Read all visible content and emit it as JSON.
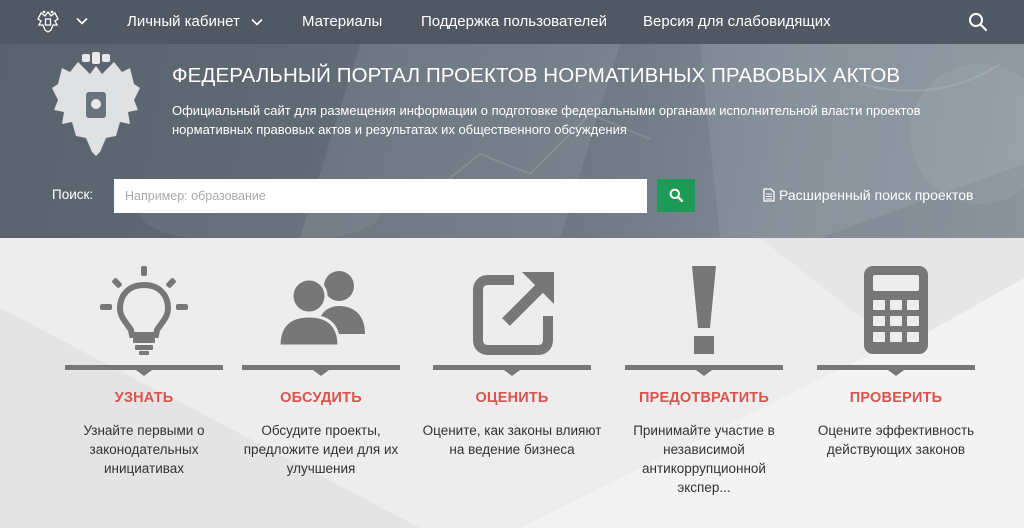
{
  "nav": {
    "items": [
      {
        "label": "Личный кабинет"
      },
      {
        "label": "Материалы"
      },
      {
        "label": "Поддержка пользователей"
      },
      {
        "label": "Версия для слабовидящих"
      }
    ],
    "icons": {
      "emblem": "coat-of-arms-icon",
      "search": "search-icon",
      "caret": "chevron-down-icon"
    }
  },
  "hero": {
    "title": "ФЕДЕРАЛЬНЫЙ ПОРТАЛ ПРОЕКТОВ НОРМАТИВНЫХ ПРАВОВЫХ АКТОВ",
    "subtitle": "Официальный сайт для размещения информации о подготовке федеральными органами исполнительной власти проектов нормативных правовых актов и результатах их общественного обсуждения",
    "search_label": "Поиск:",
    "search_value": "",
    "search_placeholder": "Например: образование",
    "advanced_search": "Расширенный поиск проектов"
  },
  "features": [
    {
      "title": "УЗНАТЬ",
      "desc": "Узнайте первыми о законодательных инициативах",
      "icon": "lightbulb-icon"
    },
    {
      "title": "ОБСУДИТЬ",
      "desc": "Обсудите проекты, предложите идеи для их улучшения",
      "icon": "people-icon"
    },
    {
      "title": "ОЦЕНИТЬ",
      "desc": "Оцените, как законы влияют на ведение бизнеса",
      "icon": "external-link-icon"
    },
    {
      "title": "ПРЕДОТВРАТИТЬ",
      "desc": "Принимайте участие в независимой антикоррупционной экспер...",
      "icon": "exclamation-icon"
    },
    {
      "title": "ПРОВЕРИТЬ",
      "desc": "Оцените эффективность действующих законов",
      "icon": "calculator-icon"
    }
  ],
  "colors": {
    "nav_bg": "#4f5863",
    "accent_red": "#d9534f",
    "search_green": "#1e9a57",
    "icon_gray": "#777777"
  }
}
